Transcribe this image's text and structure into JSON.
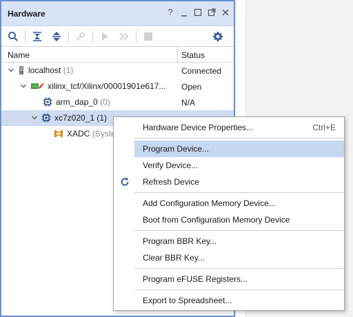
{
  "panel": {
    "title": "Hardware",
    "title_icons": [
      "help-icon",
      "minimize-icon",
      "maximize-icon",
      "float-icon",
      "close-icon"
    ]
  },
  "toolbar": {
    "buttons": [
      "search-icon",
      "collapse-all-icon",
      "expand-all-icon",
      "auto-connect-icon",
      "run-icon",
      "step-icon",
      "stop-icon",
      "settings-icon"
    ]
  },
  "columns": {
    "name": "Name",
    "status": "Status"
  },
  "tree": [
    {
      "name": "localhost",
      "count": "(1)",
      "status": "Connected"
    },
    {
      "name": "xilinx_tcf/Xilinx/00001901e617...",
      "count": "",
      "status": "Open"
    },
    {
      "name": "arm_dap_0",
      "count": "(0)",
      "status": "N/A"
    },
    {
      "name": "xc7z020_1",
      "count": "(1)",
      "status": ""
    },
    {
      "name": "XADC",
      "count": "(Syste",
      "status": ""
    }
  ],
  "menu": {
    "items": [
      {
        "label": "Hardware Device Properties...",
        "shortcut": "Ctrl+E"
      },
      {
        "label": "Program Device...",
        "shortcut": ""
      },
      {
        "label": "Verify Device...",
        "shortcut": ""
      },
      {
        "label": "Refresh Device",
        "shortcut": ""
      },
      {
        "label": "Add Configuration Memory Device...",
        "shortcut": ""
      },
      {
        "label": "Boot from Configuration Memory Device",
        "shortcut": ""
      },
      {
        "label": "Program BBR Key...",
        "shortcut": ""
      },
      {
        "label": "Clear BBR Key...",
        "shortcut": ""
      },
      {
        "label": "Program eFUSE Registers...",
        "shortcut": ""
      },
      {
        "label": "Export to Spreadsheet...",
        "shortcut": ""
      }
    ]
  },
  "colors": {
    "accent_border": "#6b8fd6",
    "titlebar_bg": "#d8e4f5",
    "selection_bg": "#cfdcf2",
    "menu_highlight": "#c5d7f1",
    "icon_blue": "#3a5f9e"
  }
}
